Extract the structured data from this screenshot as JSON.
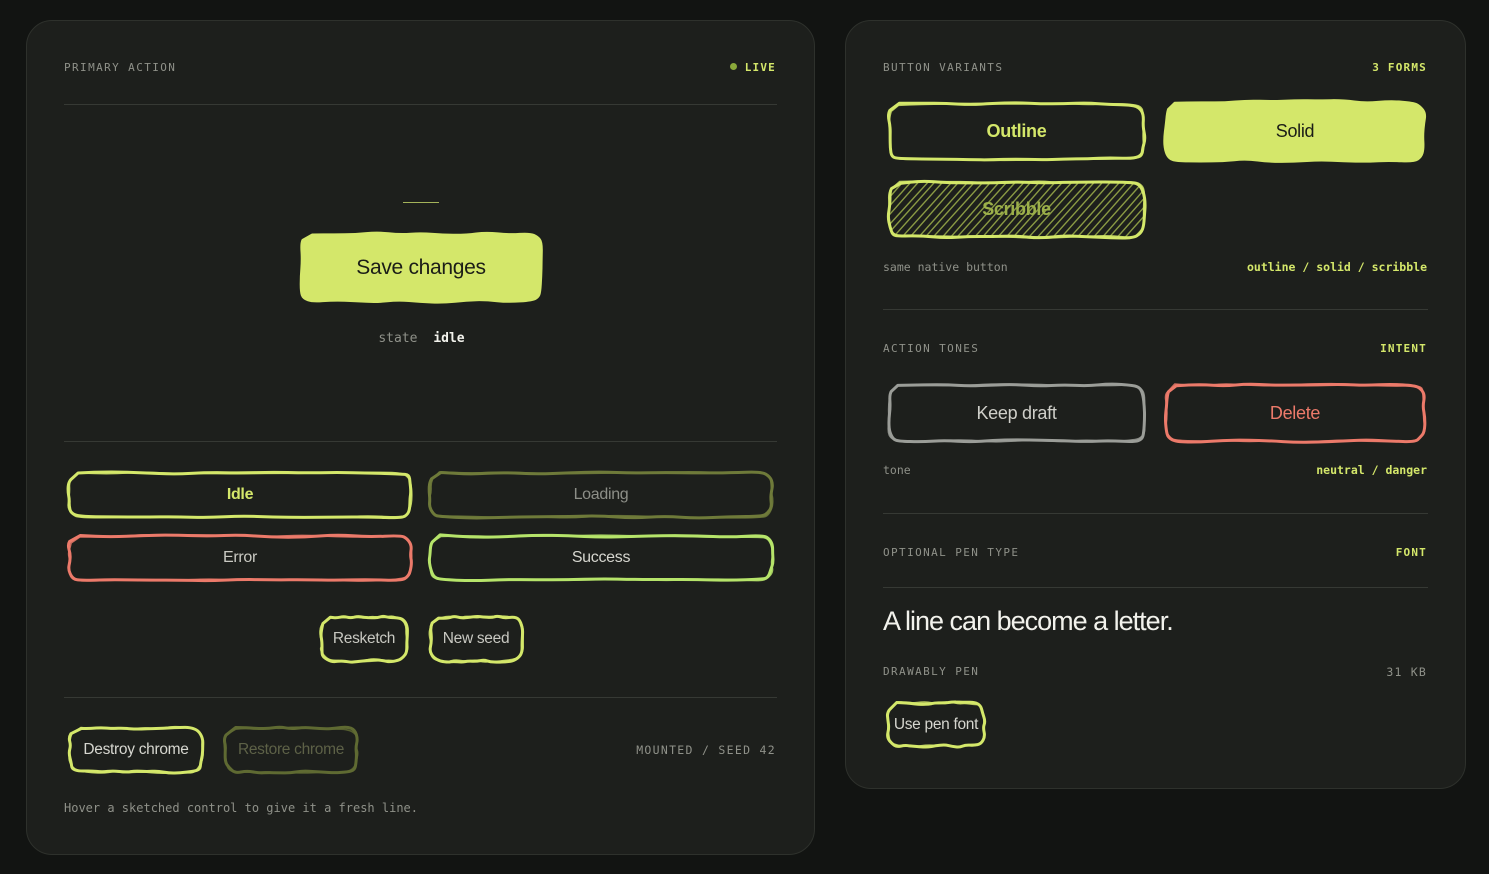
{
  "colors": {
    "accent": "#d4e76a",
    "accent_dim": "#6f7a3a",
    "danger": "#ec7a6a",
    "success": "#b6e46a",
    "neutral": "#9b9d98",
    "panel": "#1d1f1c",
    "background": "#121412"
  },
  "primary": {
    "header_label": "PRIMARY ACTION",
    "live_label": "LIVE",
    "save_button": "Save changes",
    "state_label": "state",
    "state_value": "idle",
    "states": [
      "Idle",
      "Loading",
      "Error",
      "Success"
    ],
    "resketch_button": "Resketch",
    "new_seed_button": "New seed",
    "destroy_button": "Destroy chrome",
    "restore_button": "Restore chrome",
    "mounted_status": "MOUNTED / SEED 42",
    "hint": "Hover a sketched control to give it a fresh line."
  },
  "variants": {
    "header_label": "BUTTON VARIANTS",
    "count_tag": "3 FORMS",
    "outline_button": "Outline",
    "solid_button": "Solid",
    "scribble_button": "Scribble",
    "caption_left": "same native button",
    "caption_right": "outline / solid / scribble"
  },
  "tones": {
    "header_label": "ACTION TONES",
    "tag": "INTENT",
    "keep_draft_button": "Keep draft",
    "delete_button": "Delete",
    "caption_left": "tone",
    "caption_right": "neutral / danger"
  },
  "pen": {
    "header_label": "OPTIONAL PEN TYPE",
    "tag": "FONT",
    "sample_text": "A line can become a letter.",
    "font_name": "DRAWABLY PEN",
    "font_size": "31 KB",
    "use_font_button": "Use pen font"
  }
}
